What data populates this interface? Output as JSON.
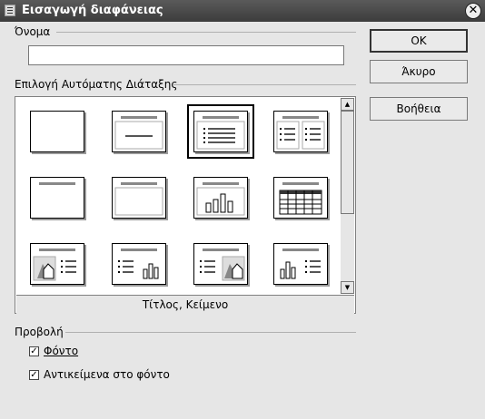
{
  "window": {
    "title": "Εισαγωγή διαφάνειας",
    "close_glyph": "✕"
  },
  "name_section": {
    "label": "Όνομα",
    "value": ""
  },
  "layout_section": {
    "label": "Επιλογή Αυτόματης Διάταξης",
    "selected_caption": "Τίτλος, Κείμενο",
    "layouts": [
      {
        "icon": "blank-layout-icon"
      },
      {
        "icon": "title-slide-layout-icon"
      },
      {
        "icon": "title-text-layout-icon",
        "selected": true
      },
      {
        "icon": "title-2-text-layout-icon"
      },
      {
        "icon": "title-only-layout-icon"
      },
      {
        "icon": "title-object-layout-icon"
      },
      {
        "icon": "title-chart-layout-icon"
      },
      {
        "icon": "title-spreadsheet-layout-icon"
      },
      {
        "icon": "title-clipart-text-layout-icon"
      },
      {
        "icon": "title-text-chart-layout-icon"
      },
      {
        "icon": "title-text-clipart-layout-icon"
      },
      {
        "icon": "title-chart-text-layout-icon"
      }
    ]
  },
  "view_section": {
    "label": "Προβολή",
    "background": {
      "label": "Φόντο",
      "checked": true
    },
    "background_objects": {
      "label": "Αντικείμενα στο φόντο",
      "checked": true
    }
  },
  "buttons": {
    "ok": "OK",
    "cancel": "Άκυρο",
    "help": "Βοήθεια"
  },
  "colors": {
    "titlebar": "#4a4a4a",
    "dialog": "#e6e6e6"
  }
}
